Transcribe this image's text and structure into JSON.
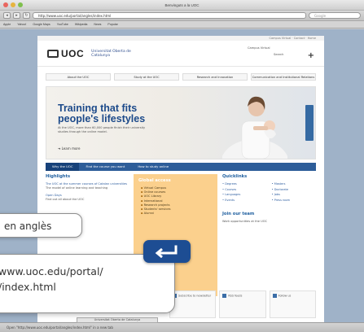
{
  "browser": {
    "window_title": "Benvinguts a la UOC",
    "url": "http://www.uoc.edu/portal/angles/index.html",
    "search_placeholder": "Google",
    "bookmarks": [
      "Apple",
      "Yahoo!",
      "Google Maps",
      "YouTube",
      "Wikipedia",
      "News",
      "Popular"
    ],
    "status": "Open \"http://www.uoc.edu/portal/angles/index.html\" in a new tab",
    "download_label": "Universitat Oberta de Catalunya"
  },
  "page": {
    "topbar": "Campus Virtual · Contact · Home",
    "logo": {
      "text": "UOC",
      "sub": "Universitat Oberta de Catalunya"
    },
    "header_right": {
      "label_1": "Campus Virtual",
      "label_2": "Search",
      "plus": "+"
    },
    "nav": [
      "About the UOC",
      "Study at the UOC",
      "Research and Innovation",
      "Communication and Institutional Relations"
    ],
    "hero": {
      "title": "Training that fits people's lifestyles",
      "text": "At the UOC, more than 60,000 people finish their university studies through the online model.",
      "more": "Learn more"
    },
    "tabs": [
      "Why the UOC",
      "Find the course you want",
      "How to study online"
    ],
    "left": {
      "heading": "Highlights",
      "link_1": "The UOC at the summer courses of Catalan universities",
      "text_1": "The model of online learning and teaching",
      "link_2": "Open Days",
      "text_2": "Find out all about the UOC"
    },
    "mid": {
      "heading": "Global access",
      "items": [
        "Virtual Campus",
        "Online courses",
        "UOC Library",
        "International",
        "Research projects",
        "Students' services",
        "Alumni"
      ]
    },
    "right": {
      "heading": "Quicklinks",
      "items": [
        "Degrees",
        "Masters",
        "Courses",
        "Doctorate",
        "Languages",
        "Jobs",
        "Events",
        "Press room"
      ],
      "subheading": "Join our team",
      "subtext": "Work opportunities at the UOC"
    },
    "bottom": [
      "Subscribe to newsletter",
      "RSS feeds",
      "Follow us"
    ]
  },
  "overlay": {
    "caption": "en anglès",
    "url_line_1": "www.uoc.edu/portal/",
    "url_line_2": "/index.html"
  },
  "colors": {
    "brand_blue": "#1c4a8a",
    "orange_panel": "#fbd08d",
    "enter_key": "#1d4d93"
  }
}
